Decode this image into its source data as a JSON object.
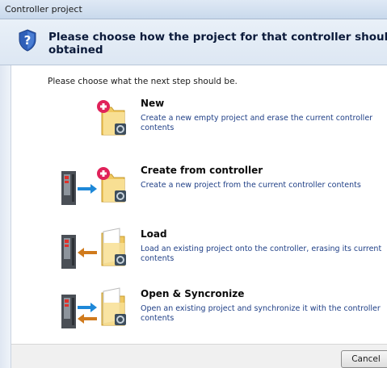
{
  "window": {
    "title": "Controller project"
  },
  "header": {
    "heading": "Please choose how the project for that controller should be obtained",
    "icon": "help-shield-icon"
  },
  "intro": "Please choose what the next step should be.",
  "options": [
    {
      "title": "New",
      "description": "Create a new empty project and erase the current controller contents",
      "icon": "new-project-icon"
    },
    {
      "title": "Create from controller",
      "description": "Create a new project from the current controller contents",
      "icon": "create-from-controller-icon"
    },
    {
      "title": "Load",
      "description": "Load an existing project onto the controller, erasing its current contents",
      "icon": "load-project-icon"
    },
    {
      "title": "Open & Syncronize",
      "description": "Open an existing project and synchronize it with the controller contents",
      "icon": "open-synchronize-icon"
    }
  ],
  "footer": {
    "cancel_label": "Cancel"
  },
  "colors": {
    "link_text": "#1f3f86",
    "arrow_blue": "#1e88d8",
    "arrow_orange": "#d07a1c",
    "plus_red": "#e0225a"
  }
}
